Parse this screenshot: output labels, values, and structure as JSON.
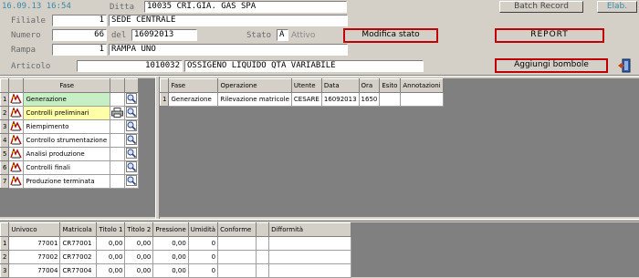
{
  "header": {
    "datetime": "16.09.13 16:54",
    "ditta_label": "Ditta",
    "ditta_code": "10035",
    "ditta_name": "CRI.GIA. GAS SPA",
    "batch_record_label": "Batch Record",
    "elab_label": "Elab.",
    "filiale_label": "Filiale",
    "filiale_code": "1",
    "filiale_name": "SEDE CENTRALE",
    "numero_label": "Numero",
    "numero_value": "66",
    "del_label": "del",
    "del_value": "16092013",
    "stato_label": "Stato",
    "stato_code": "A",
    "stato_text": "Attivo",
    "modifica_stato_label": "Modifica stato",
    "report_label": "REPORT",
    "rampa_label": "Rampa",
    "rampa_code": "1",
    "rampa_name": "RAMPA UNO",
    "articolo_label": "Articolo",
    "articolo_code": "1010032",
    "articolo_name": "OSSIGENO LIQUIDO QTA VARIABILE",
    "aggiungi_bombole_label": "Aggiungi bombole",
    "exit_icon": "exit-door-icon"
  },
  "fasi": {
    "header": "Fase",
    "rows": [
      {
        "n": "1",
        "label": "Generazione",
        "bg": "#c6efc6",
        "extra_icon": ""
      },
      {
        "n": "2",
        "label": "Controlli preliminari",
        "bg": "#ffffa8",
        "extra_icon": "printer-icon"
      },
      {
        "n": "3",
        "label": "Riempimento",
        "bg": "#ffffff",
        "extra_icon": ""
      },
      {
        "n": "4",
        "label": "Controllo strumentazione",
        "bg": "#ffffff",
        "extra_icon": ""
      },
      {
        "n": "5",
        "label": "Analisi produzione",
        "bg": "#ffffff",
        "extra_icon": ""
      },
      {
        "n": "6",
        "label": "Controlli finali",
        "bg": "#ffffff",
        "extra_icon": ""
      },
      {
        "n": "7",
        "label": "Produzione terminata",
        "bg": "#ffffff",
        "extra_icon": ""
      }
    ]
  },
  "operazioni": {
    "headers": [
      "Fase",
      "Operazione",
      "Utente",
      "Data",
      "Ora",
      "Esito",
      "Annotazioni"
    ],
    "rows": [
      {
        "n": "1",
        "cells": [
          "Generazione",
          "Rilevazione matricole",
          "CESARE",
          "16092013",
          "1650",
          "",
          ""
        ]
      }
    ]
  },
  "bombole": {
    "headers": [
      "Univoco",
      "Matricola",
      "Titolo 1",
      "Titolo 2",
      "Pressione",
      "Umidità",
      "Conforme",
      "",
      "Difformità"
    ],
    "rows": [
      {
        "n": "1",
        "cells": [
          "77001",
          "CR77001",
          "0,00",
          "0,00",
          "0,00",
          "0",
          "",
          "",
          ""
        ]
      },
      {
        "n": "2",
        "cells": [
          "77002",
          "CR77002",
          "0,00",
          "0,00",
          "0,00",
          "0",
          "",
          "",
          ""
        ]
      },
      {
        "n": "3",
        "cells": [
          "77004",
          "CR77004",
          "0,00",
          "0,00",
          "0,00",
          "0",
          "",
          "",
          ""
        ]
      }
    ]
  }
}
